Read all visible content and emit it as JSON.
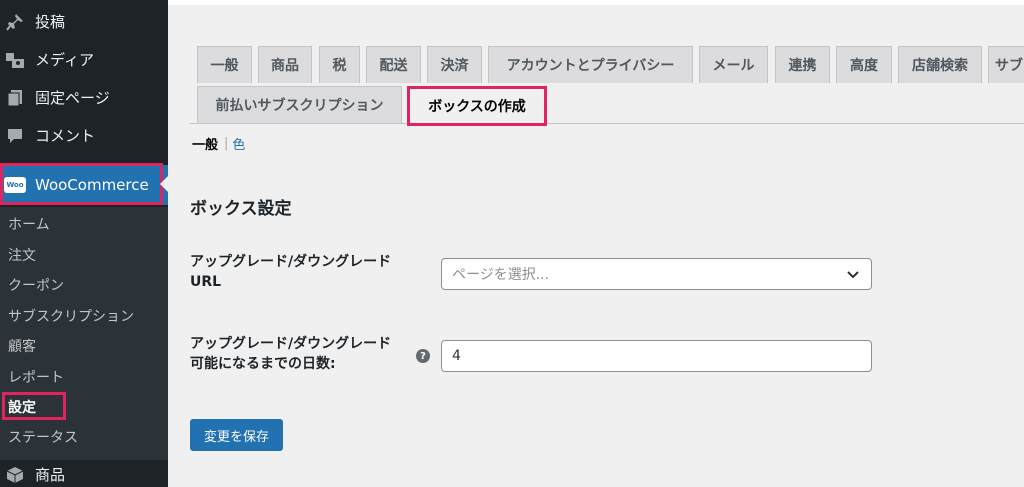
{
  "sidebar": {
    "menu": [
      {
        "label": "投稿",
        "icon": "pushpin-icon"
      },
      {
        "label": "メディア",
        "icon": "media-icon"
      },
      {
        "label": "固定ページ",
        "icon": "page-icon"
      },
      {
        "label": "コメント",
        "icon": "comment-icon"
      }
    ],
    "woocommerce": {
      "label": "WooCommerce",
      "icon": "woo-icon",
      "icon_text": "Woo"
    },
    "submenu": [
      "ホーム",
      "注文",
      "クーポン",
      "サブスクリプション",
      "顧客",
      "レポート",
      "設定",
      "ステータス"
    ],
    "current_submenu": "設定",
    "products": {
      "label": "商品",
      "icon": "products-icon"
    }
  },
  "tabs": {
    "row1": [
      "一般",
      "商品",
      "税",
      "配送",
      "決済",
      "アカウントとプライバシー",
      "メール",
      "連携",
      "高度",
      "店舗検索",
      "サブ"
    ],
    "row2": [
      "前払いサブスクリプション",
      "ボックスの作成"
    ],
    "active": "ボックスの作成"
  },
  "subsub": {
    "current": "一般",
    "separator": "|",
    "link": "色"
  },
  "section_title": "ボックス設定",
  "fields": {
    "upgrade_url": {
      "label_line1": "アップグレード/ダウングレード",
      "label_line2": "URL",
      "placeholder": "ページを選択..."
    },
    "upgrade_days": {
      "label_line1": "アップグレード/ダウングレード",
      "label_line2": "可能になるまでの日数:",
      "help": "?",
      "value": "4"
    }
  },
  "save_button": "変更を保存",
  "colors": {
    "accent": "#2271b1",
    "sidebar_bg": "#1d2327",
    "submenu_bg": "#2c3338",
    "highlight": "#e0245e"
  }
}
